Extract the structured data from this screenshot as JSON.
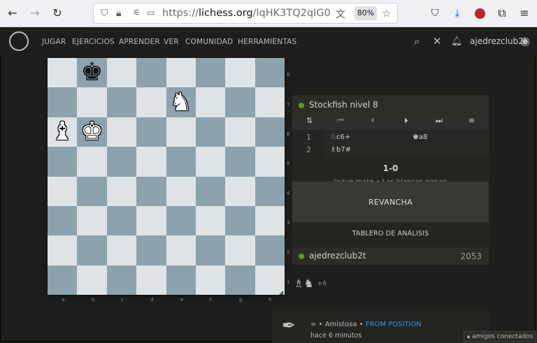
{
  "browser": {
    "url_prefix": "https://",
    "url_host": "lichess.org",
    "url_path": "/lqHK3TQ2qIG0",
    "zoom": "80%"
  },
  "site": {
    "nav": [
      "JUGAR",
      "EJERCICIOS",
      "APRENDER",
      "VER",
      "COMUNIDAD",
      "HERRAMIENTAS"
    ],
    "username": "ajedrezclub2t"
  },
  "board": {
    "ranks": [
      "8",
      "7",
      "6",
      "5",
      "4",
      "3",
      "2",
      "1"
    ],
    "files": [
      "a",
      "b",
      "c",
      "d",
      "e",
      "f",
      "g",
      "h"
    ],
    "pieces": [
      {
        "square": "b8",
        "glyph": "♚",
        "color": "black",
        "name": "black-king"
      },
      {
        "square": "e7",
        "glyph": "♞",
        "color": "white",
        "name": "white-knight"
      },
      {
        "square": "a6",
        "glyph": "♝",
        "color": "white",
        "name": "white-bishop"
      },
      {
        "square": "b6",
        "glyph": "♚",
        "color": "white",
        "name": "white-king"
      }
    ]
  },
  "panel": {
    "opponent": "Stockfish nivel 8",
    "moves": [
      {
        "num": "1",
        "white": "♘c6+",
        "black": "♚a8"
      },
      {
        "num": "2",
        "white": "♗b7#",
        "black": ""
      }
    ],
    "result": "1-0",
    "result_note": "Jaque mate • Las blancas ganan",
    "rematch": "REVANCHA",
    "analysis": "TABLERO DE ANÁLISIS",
    "player": "ajedrezclub2t",
    "rating": "2053",
    "material_count": "+6"
  },
  "game_info": {
    "mode": "∞ • Amistosa •",
    "position_link": "FROM POSITION",
    "time_ago": "hace 6 minutos"
  },
  "friends": "▴ amigos conectados",
  "colors": {
    "light_square": "#dee3e6",
    "dark_square": "#8ca2ad",
    "online_dot": "#629924",
    "link": "#3692e7"
  }
}
